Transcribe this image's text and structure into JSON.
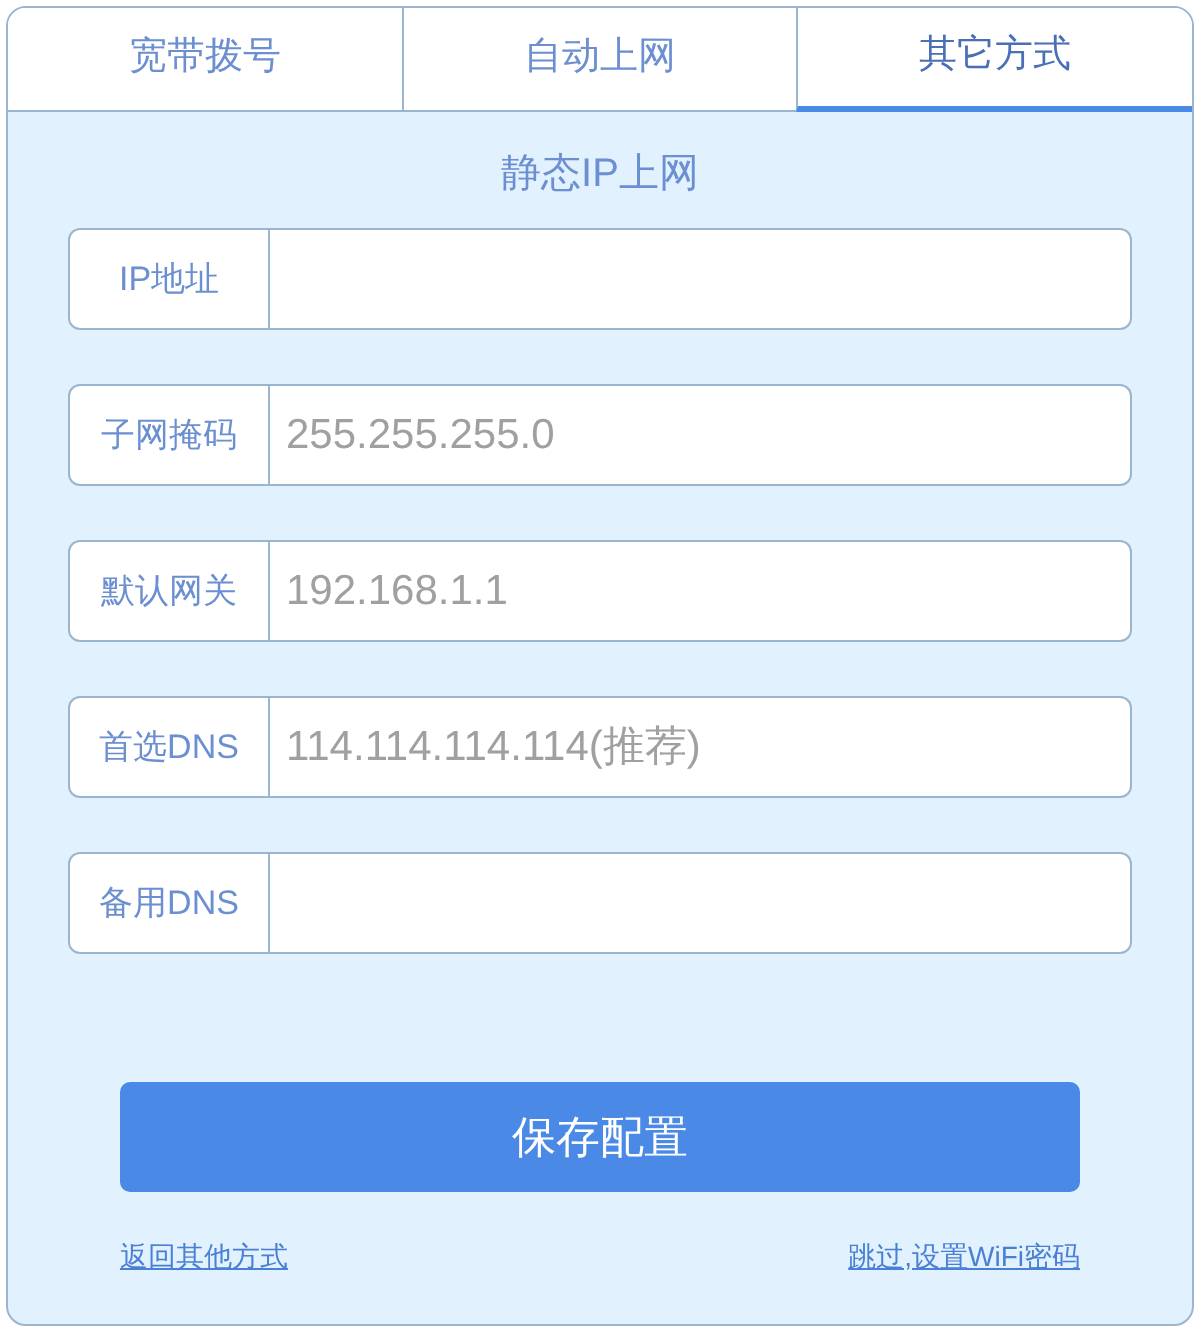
{
  "tabs": [
    {
      "label": "宽带拨号",
      "selected": false
    },
    {
      "label": "自动上网",
      "selected": false
    },
    {
      "label": "其它方式",
      "selected": true
    }
  ],
  "title": "静态IP上网",
  "fields": [
    {
      "label": "IP地址"
    },
    {
      "label": "子网掩码",
      "placeholder": "255.255.255.0"
    },
    {
      "label": "默认网关",
      "placeholder": "192.168.1.1"
    },
    {
      "label": "首选DNS",
      "placeholder": "114.114.114.114(推荐)"
    },
    {
      "label": "备用DNS"
    }
  ],
  "save_button": "保存配置",
  "links": [
    "返回其他方式",
    "跳过,设置WiFi密码"
  ]
}
